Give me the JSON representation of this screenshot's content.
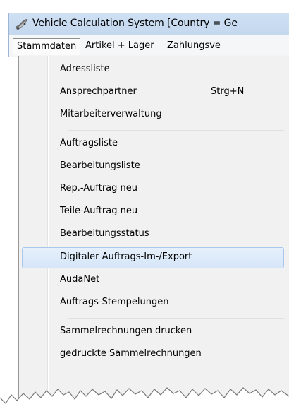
{
  "window": {
    "title": "Vehicle Calculation System [Country = Ge"
  },
  "menubar": {
    "items": [
      {
        "label": "Stammdaten",
        "active": true
      },
      {
        "label": "Artikel + Lager",
        "active": false
      },
      {
        "label": "Zahlungsve",
        "active": false
      }
    ]
  },
  "dropdown": {
    "items": [
      {
        "label": "Adressliste",
        "shortcut": ""
      },
      {
        "label": "Ansprechpartner",
        "shortcut": "Strg+N"
      },
      {
        "label": "Mitarbeiterverwaltung",
        "shortcut": ""
      },
      {
        "label": "Auftragsliste",
        "shortcut": ""
      },
      {
        "label": "Bearbeitungsliste",
        "shortcut": ""
      },
      {
        "label": "Rep.-Auftrag neu",
        "shortcut": ""
      },
      {
        "label": "Teile-Auftrag neu",
        "shortcut": ""
      },
      {
        "label": "Bearbeitungsstatus",
        "shortcut": ""
      },
      {
        "label": "Digitaler Auftrags-Im-/Export",
        "shortcut": ""
      },
      {
        "label": "AudaNet",
        "shortcut": ""
      },
      {
        "label": "Auftrags-Stempelungen",
        "shortcut": ""
      },
      {
        "label": "Sammelrechnungen drucken",
        "shortcut": ""
      },
      {
        "label": "gedruckte Sammelrechnungen",
        "shortcut": ""
      }
    ],
    "highlighted_index": 8
  },
  "colors": {
    "highlight_border": "#a9c7ea",
    "titlebar": "#c3d7ee"
  }
}
